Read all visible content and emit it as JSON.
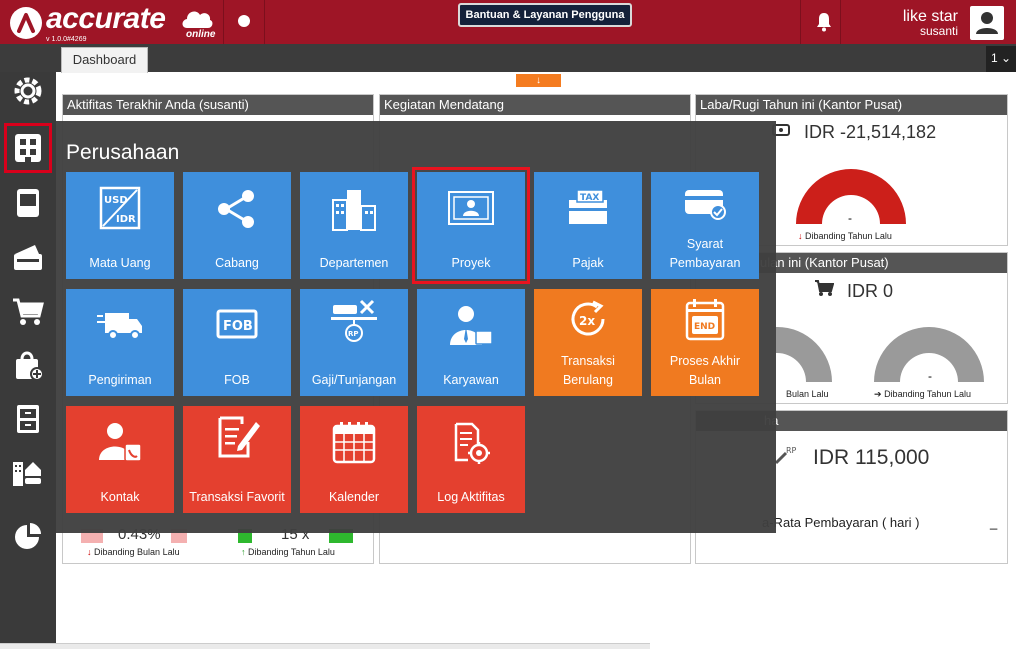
{
  "app": {
    "logo_text": "accurate",
    "logo_online": "online",
    "version": "v 1.0.0#4269",
    "help_label": "Bantuan & Layanan Pengguna",
    "user_name": "like star",
    "user_sub": "susanti"
  },
  "tabs": {
    "active": "Dashboard",
    "count": "1 ⌄"
  },
  "sidebar": {
    "items": [
      "settings-icon",
      "company-icon",
      "book-icon",
      "wallet-icon",
      "cart-icon",
      "bag-icon",
      "cabinet-icon",
      "building-car-icon",
      "pie-chart-icon"
    ]
  },
  "panels": {
    "activity": {
      "title": "Aktifitas Terakhir Anda (susanti)"
    },
    "upcoming": {
      "title": "Kegiatan Mendatang"
    },
    "profit": {
      "title": "Laba/Rugi Tahun ini (Kantor Pusat)",
      "value": "IDR -21,514,182",
      "dash": "-",
      "compare": "Dibanding Tahun Lalu"
    },
    "month": {
      "title": "ulan ini (Kantor Pusat)",
      "value": "IDR 0",
      "compare_left": "Bulan Lalu",
      "dash": "-",
      "compare_right": "Dibanding Tahun Lalu"
    },
    "third": {
      "title": "ha",
      "value": "IDR 115,000",
      "avg": "a-Rata Pembayaran ( hari )",
      "avg_val": "_"
    },
    "bottom": {
      "pct": "0.43%",
      "times": "15 x",
      "compare_month": "Dibanding Bulan Lalu",
      "compare_year": "Dibanding Tahun Lalu"
    }
  },
  "overlay": {
    "title": "Perusahaan",
    "tiles": [
      {
        "label": "Mata Uang",
        "icon": "usd-idr-icon",
        "color": "blue"
      },
      {
        "label": "Cabang",
        "icon": "share-icon",
        "color": "blue"
      },
      {
        "label": "Departemen",
        "icon": "buildings-icon",
        "color": "blue"
      },
      {
        "label": "Proyek",
        "icon": "project-icon",
        "color": "blue",
        "selected": true
      },
      {
        "label": "Pajak",
        "icon": "tax-icon",
        "color": "blue"
      },
      {
        "label": "Syarat Pembayaran",
        "icon": "card-check-icon",
        "color": "blue"
      },
      {
        "label": "Pengiriman",
        "icon": "truck-icon",
        "color": "blue"
      },
      {
        "label": "FOB",
        "icon": "fob-icon",
        "color": "blue"
      },
      {
        "label": "Gaji/Tunjangan",
        "icon": "salary-icon",
        "color": "blue"
      },
      {
        "label": "Karyawan",
        "icon": "employee-icon",
        "color": "blue"
      },
      {
        "label": "Transaksi Berulang",
        "icon": "repeat-2x-icon",
        "color": "orange"
      },
      {
        "label": "Proses Akhir Bulan",
        "icon": "calendar-end-icon",
        "color": "orange"
      },
      {
        "label": "Kontak",
        "icon": "contact-icon",
        "color": "red"
      },
      {
        "label": "Transaksi Favorit",
        "icon": "favorite-edit-icon",
        "color": "red"
      },
      {
        "label": "Kalender",
        "icon": "calendar-icon",
        "color": "red"
      },
      {
        "label": "Log Aktifitas",
        "icon": "log-icon",
        "color": "red"
      }
    ]
  },
  "colors": {
    "brand": "#9e1526",
    "tile_blue": "#3f8fdc",
    "tile_orange": "#f07a20",
    "tile_red": "#e4402f",
    "gauge_red": "#cc1f1a",
    "gauge_gray": "#9a9a9a"
  }
}
